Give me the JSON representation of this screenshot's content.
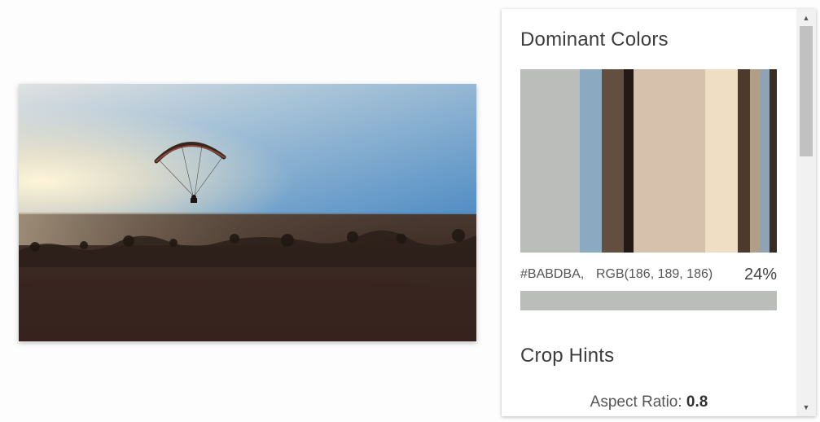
{
  "image": {
    "alt": "Paraglider over desert at sunset"
  },
  "dominant_colors": {
    "title": "Dominant Colors",
    "swatches": [
      {
        "color": "#babdba",
        "share": 24
      },
      {
        "color": "#8ba9bf",
        "share": 9
      },
      {
        "color": "#634f3f",
        "share": 9
      },
      {
        "color": "#251915",
        "share": 4
      },
      {
        "color": "#d6c2ac",
        "share": 29
      },
      {
        "color": "#efdec3",
        "share": 13
      },
      {
        "color": "#4e3a2d",
        "share": 5
      },
      {
        "color": "#b19e88",
        "share": 4
      },
      {
        "color": "#8ea4b5",
        "share": 4
      },
      {
        "color": "#3b2b22",
        "share": 3
      }
    ],
    "selected": {
      "hex": "#BABDBA,",
      "rgb": "RGB(186, 189, 186)",
      "percent": "24%",
      "color": "#babdba"
    }
  },
  "crop_hints": {
    "title": "Crop Hints",
    "aspect_label": "Aspect Ratio:",
    "aspect_value": "0.8"
  },
  "scrollbar": {
    "up_icon": "▲",
    "down_icon": "▼"
  }
}
